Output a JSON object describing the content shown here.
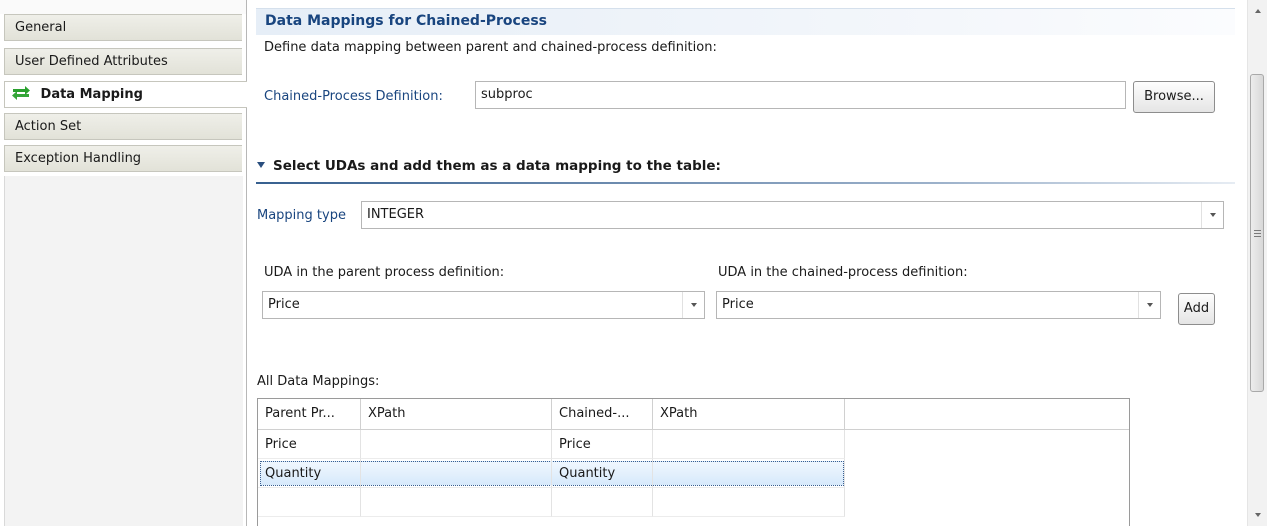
{
  "sidebar": {
    "tabs": [
      {
        "label": "General",
        "active": false
      },
      {
        "label": "User Defined Attributes",
        "active": false
      },
      {
        "label": "Data Mapping",
        "active": true,
        "icon": "data-mapping-arrows-icon"
      },
      {
        "label": "Action Set",
        "active": false
      },
      {
        "label": "Exception Handling",
        "active": false
      }
    ]
  },
  "main": {
    "section_title": "Data Mappings for Chained-Process",
    "description": "Define data mapping between parent and chained-process definition:",
    "chained_def": {
      "label": "Chained-Process Definition:",
      "value": "subproc",
      "browse_label": "Browse..."
    },
    "uda_section": {
      "title": "Select UDAs and add them as a data mapping to the table:",
      "mapping_type_label": "Mapping type",
      "mapping_type_value": "INTEGER",
      "parent_label": "UDA in the parent process definition:",
      "parent_value": "Price",
      "chained_label": "UDA in the chained-process definition:",
      "chained_value": "Price",
      "add_label": "Add"
    },
    "table": {
      "caption": "All Data Mappings:",
      "columns": [
        "Parent Pr...",
        "XPath",
        "Chained-...",
        "XPath"
      ],
      "rows": [
        {
          "parent": "Price",
          "xpath1": "",
          "chained": "Price",
          "xpath2": ""
        },
        {
          "parent": "Quantity",
          "xpath1": "",
          "chained": "Quantity",
          "xpath2": "",
          "selected": true
        }
      ]
    }
  },
  "colors": {
    "label_blue": "#19457f",
    "selection": "#d6e9fb",
    "icon_green": "#2aa12e"
  }
}
